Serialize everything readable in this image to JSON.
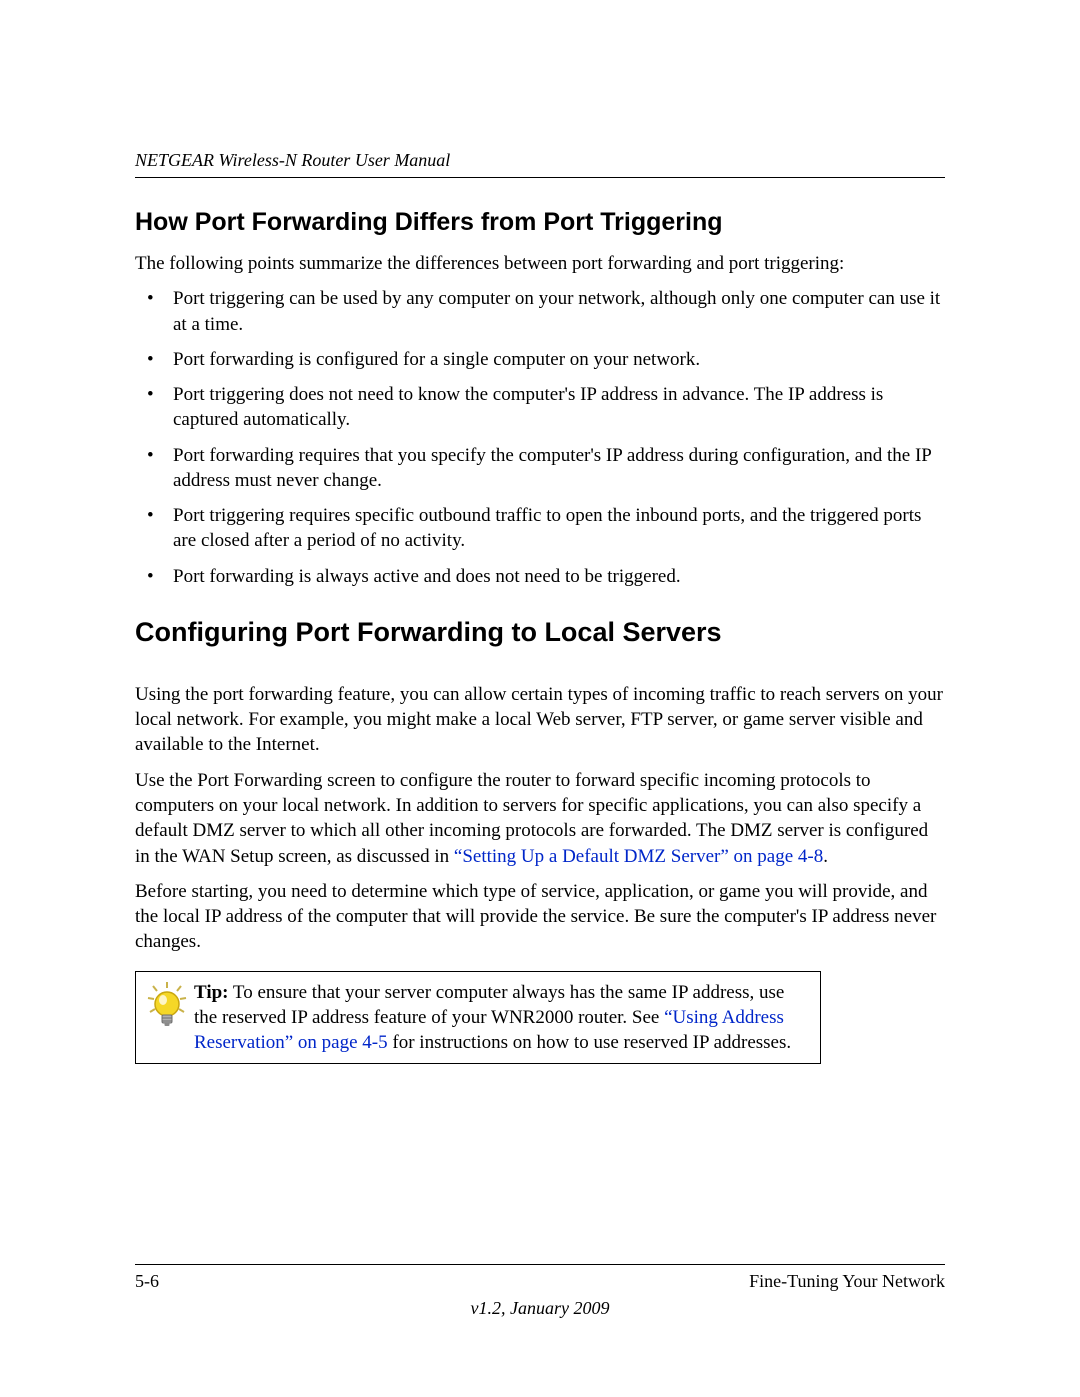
{
  "header": {
    "manual_title": "NETGEAR Wireless-N Router User Manual"
  },
  "section1": {
    "heading": "How Port Forwarding Differs from Port Triggering",
    "intro": "The following points summarize the differences between port forwarding and port triggering:",
    "bullets": [
      "Port triggering can be used by any computer on your network, although only one computer can use it at a time.",
      "Port forwarding is configured for a single computer on your network.",
      "Port triggering does not need to know the computer's IP address in advance. The IP address is captured automatically.",
      "Port forwarding requires that you specify the computer's IP address during configuration, and the IP address must never change.",
      "Port triggering requires specific outbound traffic to open the inbound ports, and the triggered ports are closed after a period of no activity.",
      "Port forwarding is always active and does not need to be triggered."
    ]
  },
  "section2": {
    "heading": "Configuring Port Forwarding to Local Servers",
    "para1": "Using the port forwarding feature, you can allow certain types of incoming traffic to reach servers on your local network. For example, you might make a local Web server, FTP server, or game server visible and available to the Internet.",
    "para2_before_link": "Use the Port Forwarding screen to configure the router to forward specific incoming protocols to computers on your local network. In addition to servers for specific applications, you can also specify a default DMZ server to which all other incoming protocols are forwarded. The DMZ server is configured in the WAN Setup screen, as discussed in ",
    "para2_link": "“Setting Up a Default DMZ Server” on page 4-8",
    "para2_after_link": ".",
    "para3": "Before starting, you need to determine which type of service, application, or game you will provide, and the local IP address of the computer that will provide the service. Be sure the computer's IP address never changes."
  },
  "tip": {
    "label": "Tip:",
    "text_before_link": " To ensure that your server computer always has the same IP address, use the reserved IP address feature of your WNR2000 router. See ",
    "link": "“Using Address Reservation” on page 4-5",
    "text_after_link": " for instructions on how to use reserved IP addresses."
  },
  "footer": {
    "page_number": "5-6",
    "chapter_title": "Fine-Tuning Your Network",
    "version": "v1.2, January 2009"
  }
}
